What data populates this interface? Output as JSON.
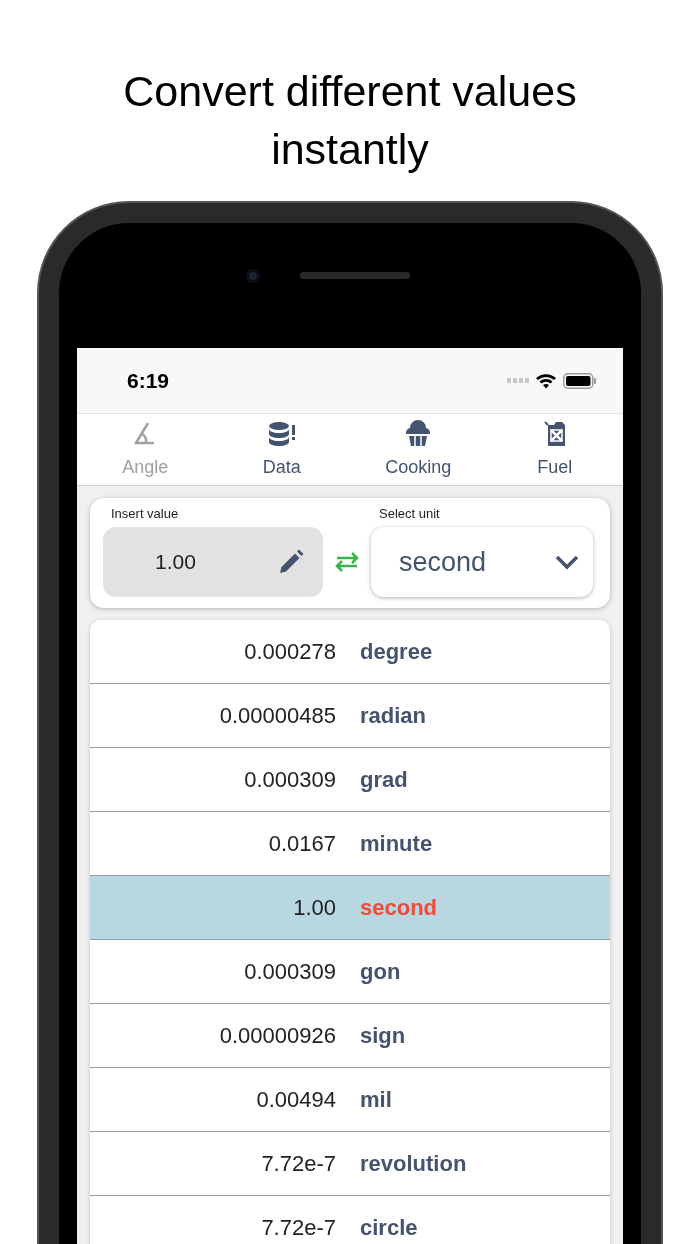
{
  "headline": "Convert different values instantly",
  "status_bar": {
    "time": "6:19"
  },
  "tabs": [
    {
      "label": "Angle",
      "kind": "angle",
      "selected": true
    },
    {
      "label": "Data",
      "kind": "database",
      "selected": false
    },
    {
      "label": "Cooking",
      "kind": "cupcake",
      "selected": false
    },
    {
      "label": "Fuel",
      "kind": "fuel",
      "selected": false
    }
  ],
  "input": {
    "label": "Insert value",
    "value": "1.00"
  },
  "unit_select": {
    "label": "Select unit",
    "value": "second"
  },
  "results": [
    {
      "value": "0.000278",
      "unit": "degree",
      "selected": false
    },
    {
      "value": "0.00000485",
      "unit": "radian",
      "selected": false
    },
    {
      "value": "0.000309",
      "unit": "grad",
      "selected": false
    },
    {
      "value": "0.0167",
      "unit": "minute",
      "selected": false
    },
    {
      "value": "1.00",
      "unit": "second",
      "selected": true
    },
    {
      "value": "0.000309",
      "unit": "gon",
      "selected": false
    },
    {
      "value": "0.00000926",
      "unit": "sign",
      "selected": false
    },
    {
      "value": "0.00494",
      "unit": "mil",
      "selected": false
    },
    {
      "value": "7.72e-7",
      "unit": "revolution",
      "selected": false
    },
    {
      "value": "7.72e-7",
      "unit": "circle",
      "selected": false
    }
  ]
}
